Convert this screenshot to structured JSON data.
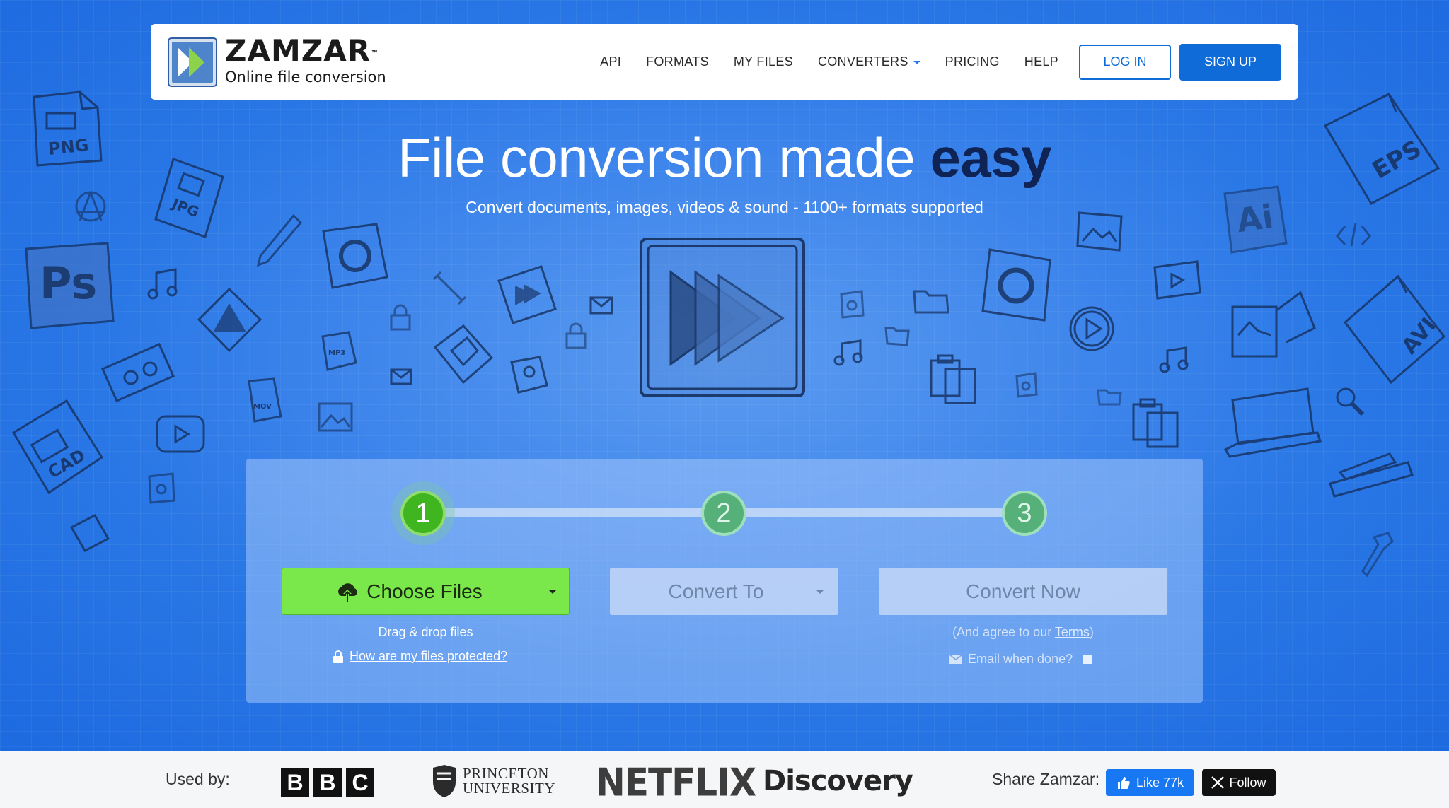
{
  "brand": {
    "name": "ZAMZAR",
    "trademark": "™",
    "tagline": "Online file conversion"
  },
  "nav": {
    "items": [
      {
        "label": "API"
      },
      {
        "label": "FORMATS"
      },
      {
        "label": "MY FILES"
      },
      {
        "label": "CONVERTERS"
      },
      {
        "label": "PRICING"
      },
      {
        "label": "HELP"
      }
    ],
    "login_label": "LOG IN",
    "signup_label": "SIGN UP"
  },
  "hero": {
    "headline_main": "File conversion made ",
    "headline_emphasis": "easy",
    "subhead": "Convert documents, images, videos & sound - 1100+ formats supported",
    "doodle_labels": [
      "PNG",
      "JPG",
      "Ps",
      "CAD",
      "EPS",
      "Ai",
      "AVI",
      "MP3",
      "MOV"
    ]
  },
  "converter": {
    "steps": [
      "1",
      "2",
      "3"
    ],
    "active_step": 1,
    "choose_files_label": "Choose Files",
    "convert_to_label": "Convert To",
    "convert_now_label": "Convert Now",
    "drag_drop_text": "Drag & drop files",
    "protected_link": "How are my files protected?",
    "agree_prefix": "(And agree to our ",
    "terms_link": "Terms",
    "agree_suffix": ")",
    "email_label": "Email when done?",
    "email_checked": false
  },
  "footer": {
    "used_by_label": "Used by:",
    "logos": {
      "bbc": [
        "B",
        "B",
        "C"
      ],
      "princeton_line1": "PRINCETON",
      "princeton_line2": "UNIVERSITY",
      "netflix": "NETFLIX",
      "discovery": "Discovery"
    },
    "share_label": "Share Zamzar:",
    "like_label": "Like 77k",
    "follow_label": "Follow"
  },
  "colors": {
    "brand_blue": "#0e6bd8",
    "hero_blue": "#2a78e6",
    "step_active": "#3fb51f",
    "choose_green": "#7ae84a",
    "headline_dark": "#0f2354",
    "facebook": "#1877f2"
  }
}
